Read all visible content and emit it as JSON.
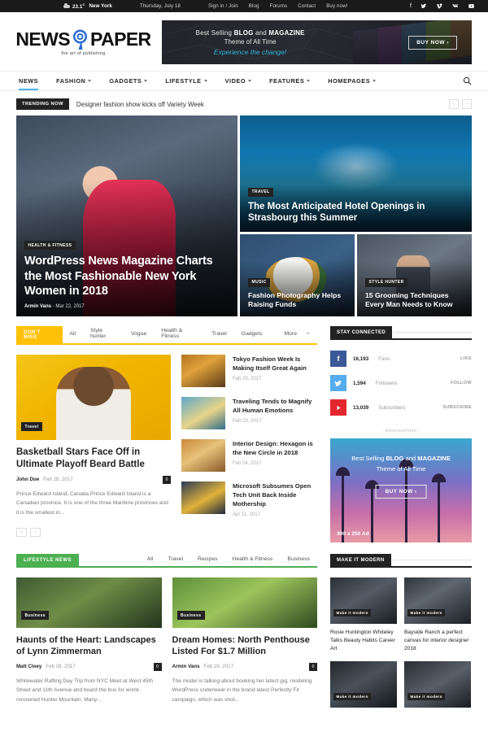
{
  "topbar": {
    "temperature": "23.1",
    "temp_unit": "C",
    "city": "New York",
    "date": "Thursday, July 18",
    "links": [
      "Sign in / Join",
      "Blog",
      "Forums",
      "Contact",
      "Buy now!"
    ],
    "social_icons": [
      "facebook-icon",
      "twitter-icon",
      "vimeo-icon",
      "vk-icon",
      "youtube-icon"
    ]
  },
  "header": {
    "logo_first": "NEWS",
    "logo_second": "PAPER",
    "logo_tagline": "the art of publishing",
    "banner": {
      "line1_pre": "Best Selling ",
      "line1_b1": "BLOG",
      "line1_mid": " and ",
      "line1_b2": "MAGAZINE",
      "line2": "Theme of All Time",
      "line3": "Experience the change!",
      "button": "BUY NOW  ›"
    }
  },
  "nav": {
    "items": [
      {
        "label": "NEWS",
        "caret": false,
        "active": true
      },
      {
        "label": "FASHION",
        "caret": true,
        "active": false
      },
      {
        "label": "GADGETS",
        "caret": true,
        "active": false
      },
      {
        "label": "LIFESTYLE",
        "caret": true,
        "active": false
      },
      {
        "label": "VIDEO",
        "caret": true,
        "active": false
      },
      {
        "label": "FEATURES",
        "caret": true,
        "active": false
      },
      {
        "label": "HOMEPAGES",
        "caret": true,
        "active": false
      }
    ]
  },
  "trending": {
    "badge": "TRENDING NOW",
    "text": "Designer fashion show kicks off Variety Week",
    "prev": "‹",
    "next": "›"
  },
  "hero": {
    "main": {
      "category": "HEALTH & FITNESS",
      "title": "WordPress News Magazine Charts the Most Fashionable New York Women in 2018",
      "author": "Armin Vans",
      "date": "Mar 22, 2017"
    },
    "top_right": {
      "category": "TRAVEL",
      "title": "The Most Anticipated Hotel Openings in Strasbourg this Summer"
    },
    "bottom_left": {
      "category": "MUSIC",
      "title": "Fashion Photography Helps Raising Funds"
    },
    "bottom_right": {
      "category": "STYLE HUNTER",
      "title": "15 Grooming Techniques Every Man Needs to Know"
    }
  },
  "dont_miss": {
    "badge": "DON'T MISS",
    "filters": [
      "All",
      "Style hunter",
      "Vogue",
      "Health & Fitness",
      "Travel",
      "Gadgets",
      "More"
    ],
    "feature": {
      "category": "Travel",
      "title": "Basketball Stars Face Off in Ultimate Playoff Beard Battle",
      "author": "John Doe",
      "date": "Feb 28, 2017",
      "comments": "0",
      "excerpt": "Prince Edward Island, Canada Prince Edward Island is a Canadian province. It is one of the three Maritime provinces and it is the smallest in..."
    },
    "pager": [
      "‹",
      "›"
    ],
    "posts": [
      {
        "title": "Tokyo Fashion Week Is Making Itself Great Again",
        "date": "Feb 25, 2017"
      },
      {
        "title": "Traveling Tends to Magnify All Human Emotions",
        "date": "Feb 23, 2017"
      },
      {
        "title": "Interior Design: Hexagon is the New Circle in 2018",
        "date": "Feb 24, 2017"
      },
      {
        "title": "Microsoft Subsumes Open Tech Unit Back Inside Mothership",
        "date": "Apr 11, 2017"
      }
    ]
  },
  "stay_connected": {
    "title": "STAY CONNECTED",
    "items": [
      {
        "icon": "facebook-icon",
        "count": "16,193",
        "label": "Fans",
        "action": "LIKE",
        "color": "#3b5998"
      },
      {
        "icon": "twitter-icon",
        "count": "1,594",
        "label": "Followers",
        "action": "FOLLOW",
        "color": "#55acee"
      },
      {
        "icon": "youtube-icon",
        "count": "13,039",
        "label": "Subscribers",
        "action": "SUBSCRIBE",
        "color": "#e4262c"
      }
    ]
  },
  "ad": {
    "label": "- Advertisement -",
    "line1_pre": "Best Selling ",
    "line1_b1": "BLOG",
    "line1_mid": " and ",
    "line1_b2": "MAGAZINE",
    "line2": "Theme of All Time",
    "button": "BUY NOW  ›",
    "size": "300 x 250 Ad"
  },
  "lifestyle": {
    "badge": "LIFESTYLE NEWS",
    "filters": [
      "All",
      "Travel",
      "Recipes",
      "Health & Fitness",
      "Business"
    ],
    "cards": [
      {
        "category": "Business",
        "title": "Haunts of the Heart: Landscapes of Lynn Zimmerman",
        "author": "Matt Cloey",
        "date": "Feb 28, 2017",
        "comments": "0",
        "excerpt": "Whitewater Rafting Day Trip from NYC Meet at West 45th Street and 11th Avenue and board the bus for world-renowned Hunter Mountain. Many..."
      },
      {
        "category": "Business",
        "title": "Dream Homes: North Penthouse Listed For $1.7 Million",
        "author": "Armin Vans",
        "date": "Feb 28, 2017",
        "comments": "0",
        "excerpt": "The model is talking about booking her latest gig, modeling WordPress underwear in the brand latest Perfectly Fit campaign, which was shot..."
      }
    ]
  },
  "make_it_modern": {
    "title": "MAKE IT MODERN",
    "items": [
      {
        "category": "Make it modern",
        "title": "Rosie Huntington Whiteley Talks Beauty Habits Career Art"
      },
      {
        "category": "Make it modern",
        "title": "Bayside Ranch a perfect canvas for interior designer 2018"
      },
      {
        "category": "Make it modern",
        "title": ""
      },
      {
        "category": "Make it modern",
        "title": ""
      }
    ]
  }
}
